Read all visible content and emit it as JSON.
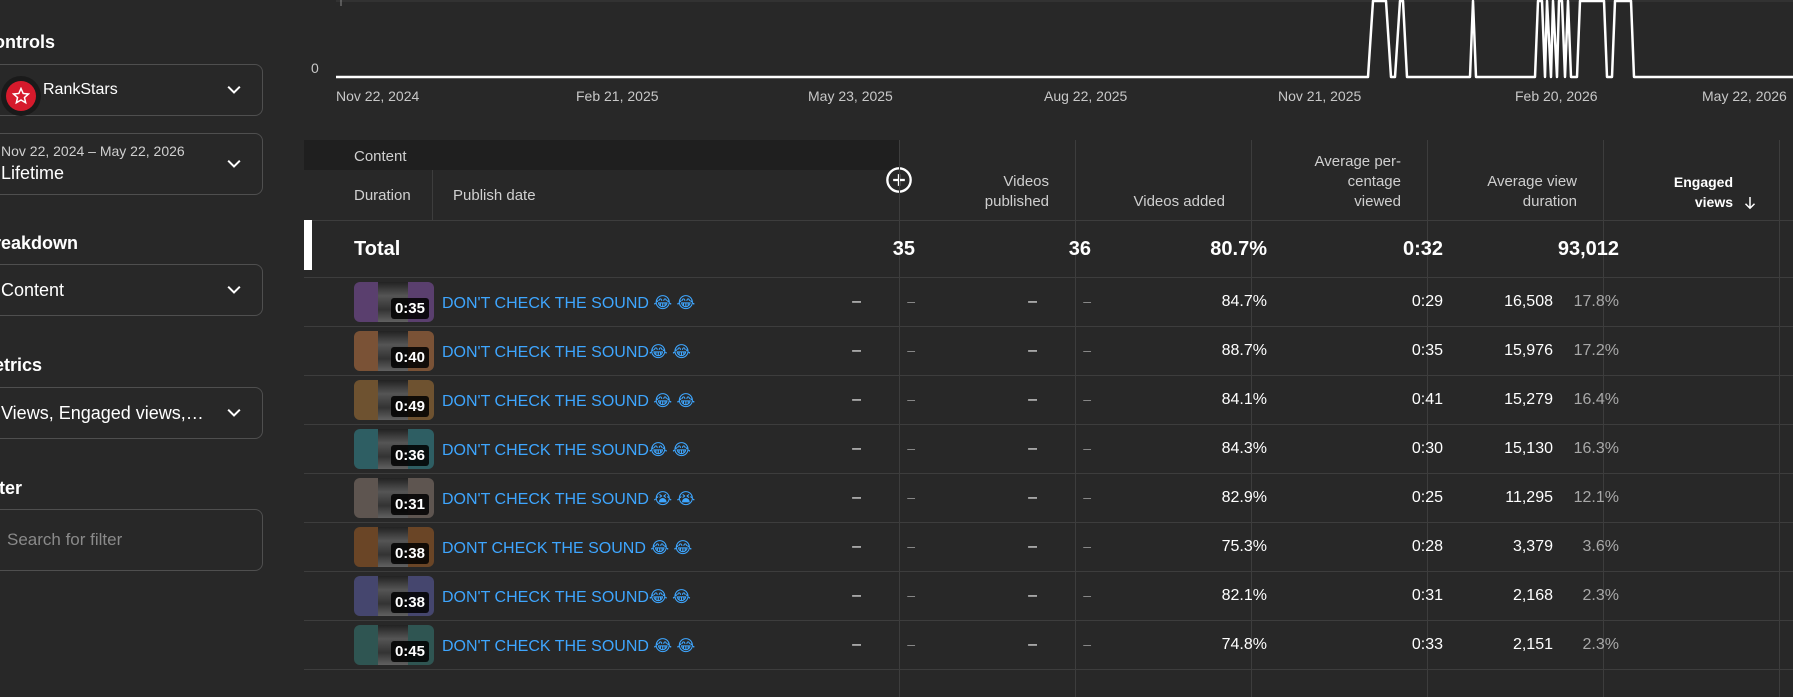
{
  "sidebar": {
    "controls_label": "ontrols",
    "channel": {
      "name": "RankStars"
    },
    "date_range": {
      "range": "Nov 22, 2024 – May 22, 2026",
      "value": "Lifetime"
    },
    "breakdown_label": "reakdown",
    "breakdown_value": "Content",
    "metrics_label": "etrics",
    "metrics_value": "Views, Engaged views,…",
    "filter_label": "lter",
    "filter_placeholder": "Search for filter"
  },
  "chart": {
    "y_ticks": [
      "0"
    ],
    "x_ticks": [
      "Nov 22, 2024",
      "Feb 21, 2025",
      "May 23, 2025",
      "Aug 22, 2025",
      "Nov 21, 2025",
      "Feb 20, 2026",
      "May 22, 2026"
    ],
    "line_color": "#ffffff"
  },
  "table": {
    "content_label": "Content",
    "duration_label": "Duration",
    "publish_date_label": "Publish date",
    "add_column_icon": "plus-circle-icon",
    "headers": {
      "videos_published": [
        "Videos",
        "published"
      ],
      "videos_added": "Videos added",
      "avg_pct_viewed": [
        "Average per-",
        "centage",
        "viewed"
      ],
      "avg_view_duration": [
        "Average view",
        "duration"
      ],
      "engaged_views": [
        "Engaged",
        "views"
      ]
    },
    "total": {
      "label": "Total",
      "videos_published": "35",
      "videos_added": "36",
      "avg_pct_viewed": "80.7%",
      "avg_view_duration": "0:32",
      "engaged_views": "93,012"
    },
    "rows": [
      {
        "duration": "0:35",
        "title": "DON'T CHECK THE SOUND 😂 😂",
        "vp": "–",
        "vp2": "–",
        "va": "–",
        "va2": "–",
        "pct": "84.7%",
        "avd": "0:29",
        "ev": "16,508",
        "evp": "17.8%",
        "thumb": "#5a3f6e"
      },
      {
        "duration": "0:40",
        "title": "DON'T CHECK THE SOUND😂 😂",
        "vp": "–",
        "vp2": "–",
        "va": "–",
        "va2": "–",
        "pct": "88.7%",
        "avd": "0:35",
        "ev": "15,976",
        "evp": "17.2%",
        "thumb": "#7a5236"
      },
      {
        "duration": "0:49",
        "title": "DON'T CHECK THE SOUND 😂 😂",
        "vp": "–",
        "vp2": "–",
        "va": "–",
        "va2": "–",
        "pct": "84.1%",
        "avd": "0:41",
        "ev": "15,279",
        "evp": "16.4%",
        "thumb": "#6e5230"
      },
      {
        "duration": "0:36",
        "title": "DON'T CHECK THE SOUND😂 😂",
        "vp": "–",
        "vp2": "–",
        "va": "–",
        "va2": "–",
        "pct": "84.3%",
        "avd": "0:30",
        "ev": "15,130",
        "evp": "16.3%",
        "thumb": "#2e5e63"
      },
      {
        "duration": "0:31",
        "title": "DON'T CHECK THE SOUND 😭 😭",
        "vp": "–",
        "vp2": "–",
        "va": "–",
        "va2": "–",
        "pct": "82.9%",
        "avd": "0:25",
        "ev": "11,295",
        "evp": "12.1%",
        "thumb": "#5e5550"
      },
      {
        "duration": "0:38",
        "title": "DONT CHECK THE SOUND 😂 😂",
        "vp": "–",
        "vp2": "–",
        "va": "–",
        "va2": "–",
        "pct": "75.3%",
        "avd": "0:28",
        "ev": "3,379",
        "evp": "3.6%",
        "thumb": "#6a4526"
      },
      {
        "duration": "0:38",
        "title": "DON'T CHECK THE SOUND😂 😂",
        "vp": "–",
        "vp2": "–",
        "va": "–",
        "va2": "–",
        "pct": "82.1%",
        "avd": "0:31",
        "ev": "2,168",
        "evp": "2.3%",
        "thumb": "#45466e"
      },
      {
        "duration": "0:45",
        "title": "DON'T CHECK THE SOUND 😂 😂",
        "vp": "–",
        "vp2": "–",
        "va": "–",
        "va2": "–",
        "pct": "74.8%",
        "avd": "0:33",
        "ev": "2,151",
        "evp": "2.3%",
        "thumb": "#2f5552"
      }
    ]
  }
}
